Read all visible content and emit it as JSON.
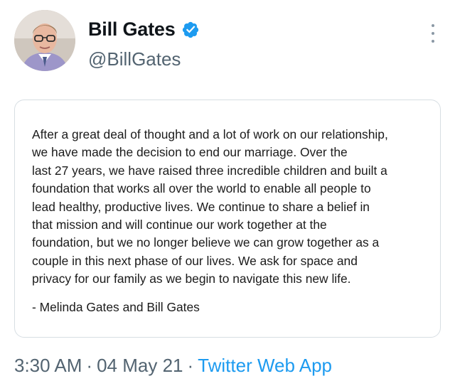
{
  "author": {
    "display_name": "Bill Gates",
    "handle": "@BillGates",
    "avatar_icon": "profile-photo",
    "verified_icon": "verified-badge-icon",
    "verified_color": "#1d9bf0"
  },
  "menu_icon": "more-vertical-icon",
  "attachment": {
    "statement_lines": [
      "After a great deal of thought and a lot of work on our relationship,",
      "we have made the decision to end our marriage. Over the",
      "last 27 years, we have raised three incredible children and built a",
      "foundation that works all over the world to enable all people to",
      "lead healthy, productive lives. We continue to share a belief in",
      "that mission and will continue our work together at the",
      "foundation, but we no longer believe we can grow together as a",
      "couple in this next phase of our lives. We ask for space and",
      "privacy for our family as we begin to navigate this new life."
    ],
    "signature": "- Melinda Gates and Bill Gates"
  },
  "meta": {
    "time": "3:30 AM",
    "separator": "·",
    "date": "04 May 21",
    "source": "Twitter Web App",
    "link_color": "#1d9bf0"
  }
}
